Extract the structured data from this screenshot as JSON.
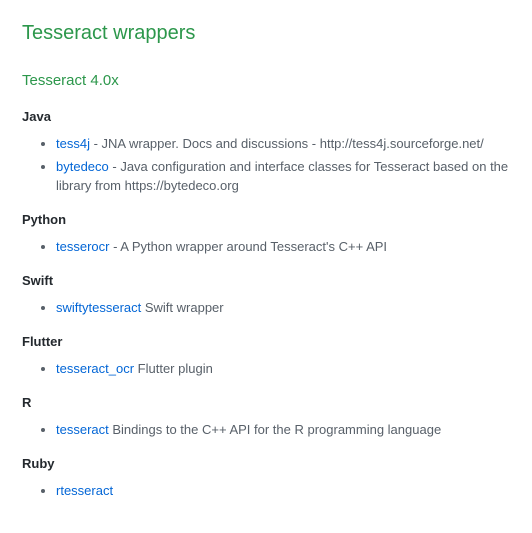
{
  "title": "Tesseract wrappers",
  "version_heading": "Tesseract 4.0x",
  "sections": {
    "java": {
      "heading": "Java",
      "items": [
        {
          "link": "tess4j",
          "text": " - JNA wrapper. Docs and discussions - http://tess4j.sourceforge.net/"
        },
        {
          "link": "bytedeco",
          "text": " - Java configuration and interface classes for Tesseract based on the library from https://bytedeco.org"
        }
      ]
    },
    "python": {
      "heading": "Python",
      "items": [
        {
          "link": "tesserocr",
          "text": " - A Python wrapper around Tesseract's C++ API"
        }
      ]
    },
    "swift": {
      "heading": "Swift",
      "items": [
        {
          "link": "swiftytesseract",
          "text": " Swift wrapper"
        }
      ]
    },
    "flutter": {
      "heading": "Flutter",
      "items": [
        {
          "link": "tesseract_ocr",
          "text": " Flutter plugin"
        }
      ]
    },
    "r": {
      "heading": "R",
      "items": [
        {
          "link": "tesseract",
          "text": " Bindings to the C++ API for the R programming language"
        }
      ]
    },
    "ruby": {
      "heading": "Ruby",
      "items": [
        {
          "link": "rtesseract",
          "text": ""
        }
      ]
    }
  }
}
